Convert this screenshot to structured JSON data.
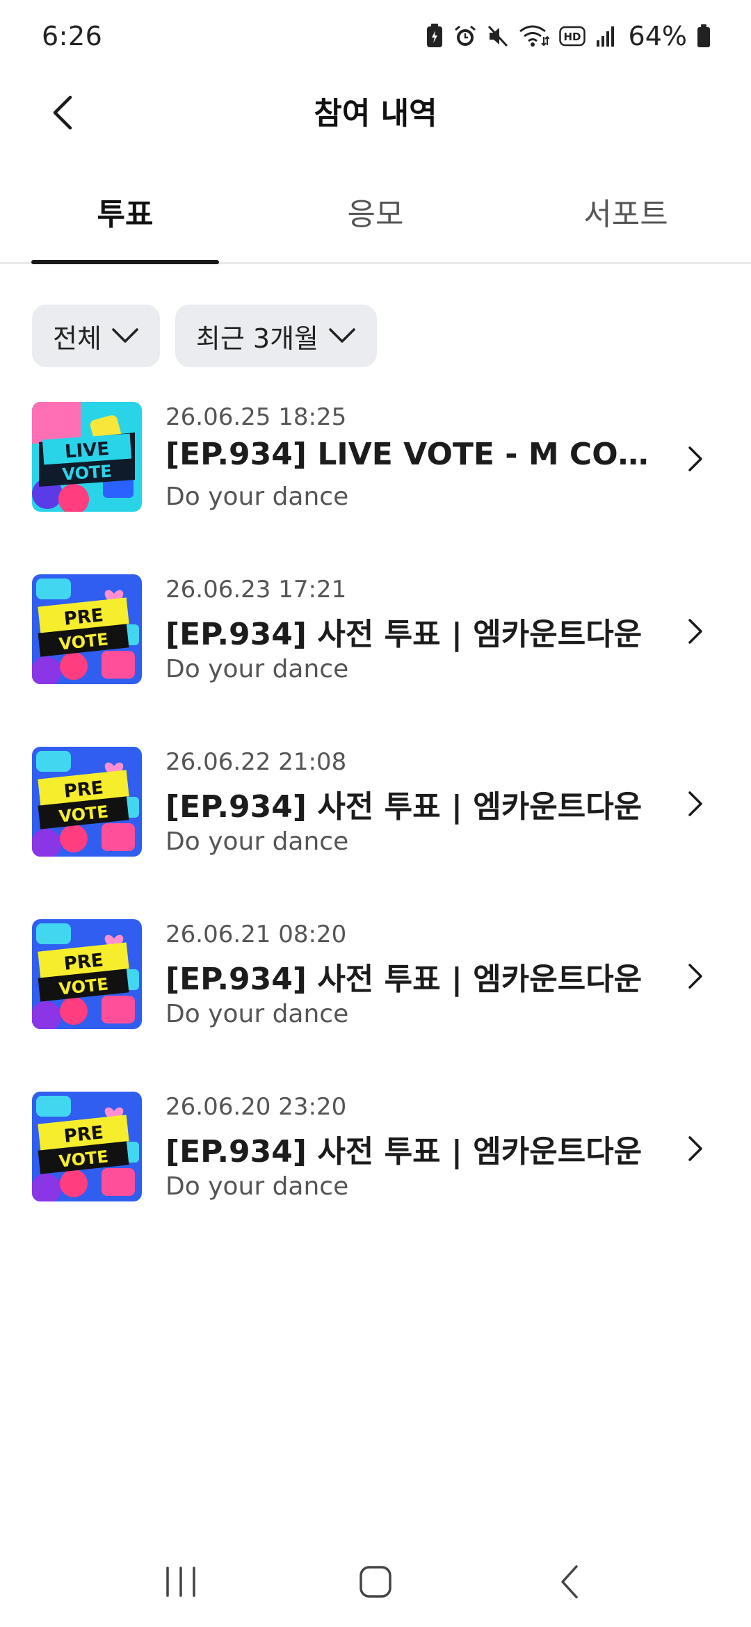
{
  "status_bar": {
    "time": "6:26",
    "battery_percent": "64%",
    "icons": [
      "battery-saver-icon",
      "alarm-icon",
      "mute-icon",
      "wifi-icon",
      "hd-icon",
      "signal-icon",
      "battery-icon"
    ]
  },
  "header": {
    "title": "참여 내역",
    "back_icon": "chevron-left-icon"
  },
  "tabs": [
    {
      "label": "투표",
      "active": true
    },
    {
      "label": "응모",
      "active": false
    },
    {
      "label": "서포트",
      "active": false
    }
  ],
  "filters": {
    "type": {
      "label": "전체",
      "icon": "chevron-down-icon"
    },
    "period": {
      "label": "최근 3개월",
      "icon": "chevron-down-icon"
    }
  },
  "items": [
    {
      "date": "26.06.25 18:25",
      "title": "[EP.934] LIVE VOTE - M COUN...",
      "subtitle": "Do your dance",
      "thumb_line1": "LIVE",
      "thumb_line2": "VOTE",
      "thumb_variant": "live"
    },
    {
      "date": "26.06.23 17:21",
      "title": "[EP.934] 사전 투표 | 엠카운트다운",
      "subtitle": "Do your dance",
      "thumb_line1": "PRE",
      "thumb_line2": "VOTE",
      "thumb_variant": "pre"
    },
    {
      "date": "26.06.22 21:08",
      "title": "[EP.934] 사전 투표 | 엠카운트다운",
      "subtitle": "Do your dance",
      "thumb_line1": "PRE",
      "thumb_line2": "VOTE",
      "thumb_variant": "pre"
    },
    {
      "date": "26.06.21 08:20",
      "title": "[EP.934] 사전 투표 | 엠카운트다운",
      "subtitle": "Do your dance",
      "thumb_line1": "PRE",
      "thumb_line2": "VOTE",
      "thumb_variant": "pre"
    },
    {
      "date": "26.06.20 23:20",
      "title": "[EP.934] 사전 투표 | 엠카운트다운",
      "subtitle": "Do your dance",
      "thumb_line1": "PRE",
      "thumb_line2": "VOTE",
      "thumb_variant": "pre"
    }
  ],
  "nav_bar": {
    "recent_icon": "recent-apps-icon",
    "home_icon": "home-icon",
    "back_icon": "back-icon"
  },
  "colors": {
    "active_tab_indicator": "#1a1a1a",
    "chip_bg": "#ebecef",
    "live_thumb_bg": "#29d4e8",
    "pre_thumb_bg": "#2f5ef0",
    "pre_banner": "#f6ee2c"
  }
}
